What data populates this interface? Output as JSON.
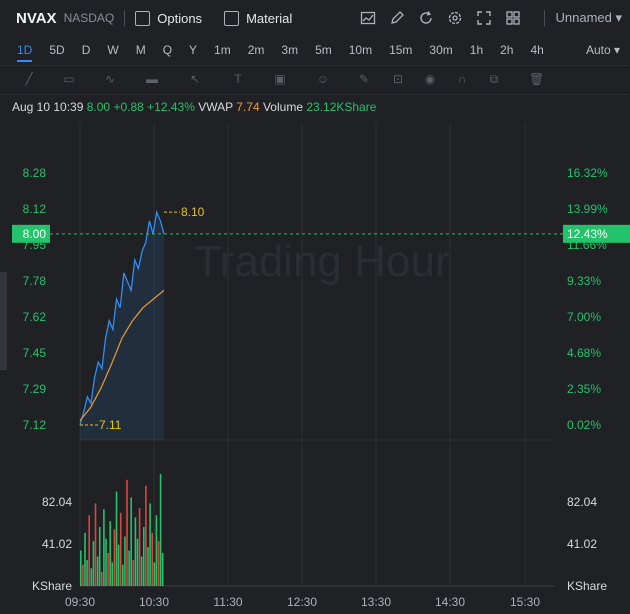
{
  "header": {
    "symbol": "NVAX",
    "exchange": "NASDAQ",
    "options_label": "Options",
    "material_label": "Material",
    "layout_name": "Unnamed"
  },
  "timeframes": [
    "1D",
    "5D",
    "D",
    "W",
    "M",
    "Q",
    "Y",
    "1m",
    "2m",
    "3m",
    "5m",
    "10m",
    "15m",
    "30m",
    "1h",
    "2h",
    "4h"
  ],
  "active_timeframe": "1D",
  "scale_mode": "Auto",
  "info": {
    "datetime": "Aug 10 10:39",
    "price": "8.00",
    "change": "+0.88",
    "change_pct": "+12.43%",
    "vwap_label": "VWAP",
    "vwap": "7.74",
    "volume_label": "Volume",
    "volume": "23.12KShare"
  },
  "chart": {
    "watermark": "Trading Hour",
    "last_price_label": "8.00",
    "last_pct_label": "12.43%",
    "high_label": "8.10",
    "low_label": "7.11",
    "price_ticks": [
      "8.28",
      "8.12",
      "7.95",
      "7.78",
      "7.62",
      "7.45",
      "7.29",
      "7.12"
    ],
    "pct_ticks": [
      "16.32%",
      "13.99%",
      "11.66%",
      "9.33%",
      "7.00%",
      "4.68%",
      "2.35%",
      "0.02%"
    ],
    "volume_ticks": [
      "82.04",
      "41.02"
    ],
    "volume_unit": "KShare",
    "time_ticks": [
      "09:30",
      "10:30",
      "11:30",
      "12:30",
      "13:30",
      "14:30",
      "15:30"
    ],
    "colors": {
      "up": "#22c36a",
      "down": "#e0443d",
      "price_line": "#2f8df5",
      "vwap_line": "#f19a2a"
    }
  },
  "chart_data": {
    "type": "line",
    "series": [
      {
        "name": "VWAP",
        "values_approx": [
          7.14,
          7.2,
          7.29,
          7.4,
          7.52,
          7.6,
          7.66,
          7.7,
          7.74
        ]
      },
      {
        "values_approx": [
          7.12,
          7.22,
          7.35,
          7.45,
          7.55,
          7.62,
          7.7,
          7.78,
          7.86,
          7.95,
          8.05,
          8.1,
          8.0
        ]
      }
    ],
    "ylim": [
      7.12,
      8.28
    ],
    "x_range": [
      "09:30",
      "16:00"
    ]
  }
}
